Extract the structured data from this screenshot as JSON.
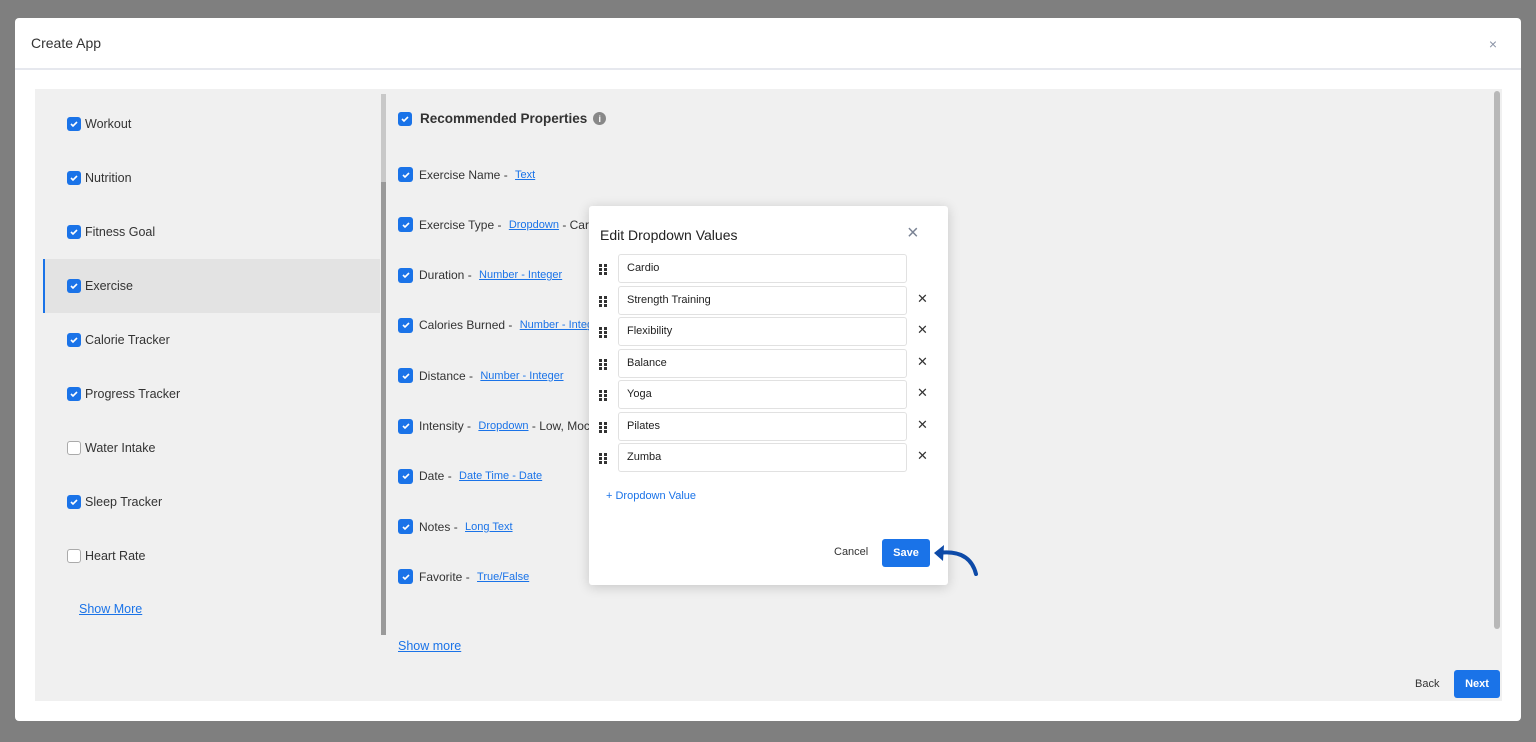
{
  "dialog": {
    "title": "Create App",
    "close": "×"
  },
  "sidebar": {
    "items": [
      {
        "label": "Workout",
        "checked": true
      },
      {
        "label": "Nutrition",
        "checked": true
      },
      {
        "label": "Fitness Goal",
        "checked": true
      },
      {
        "label": "Exercise",
        "checked": true,
        "selected": true
      },
      {
        "label": "Calorie Tracker",
        "checked": true
      },
      {
        "label": "Progress Tracker",
        "checked": true
      },
      {
        "label": "Water Intake",
        "checked": false
      },
      {
        "label": "Sleep Tracker",
        "checked": true
      },
      {
        "label": "Heart Rate",
        "checked": false
      }
    ],
    "show_more": "Show More"
  },
  "properties": {
    "heading": "Recommended Properties",
    "info_icon": "i",
    "items": [
      {
        "name": "Exercise Name",
        "type": "Text",
        "extra": ""
      },
      {
        "name": "Exercise Type",
        "type": "Dropdown",
        "extra": "- Card"
      },
      {
        "name": "Duration",
        "type": "Number - Integer",
        "extra": ""
      },
      {
        "name": "Calories Burned",
        "type": "Number - Integ",
        "extra": ""
      },
      {
        "name": "Distance",
        "type": "Number - Integer",
        "extra": ""
      },
      {
        "name": "Intensity",
        "type": "Dropdown",
        "extra": "- Low, Moc"
      },
      {
        "name": "Date",
        "type": "Date Time - Date",
        "extra": ""
      },
      {
        "name": "Notes",
        "type": "Long Text",
        "extra": ""
      },
      {
        "name": "Favorite",
        "type": "True/False",
        "extra": ""
      }
    ],
    "show_more": "Show more"
  },
  "footer": {
    "back": "Back",
    "next": "Next"
  },
  "modal": {
    "title": "Edit Dropdown Values",
    "close": "×",
    "values": [
      "Cardio",
      "Strength Training",
      "Flexibility",
      "Balance",
      "Yoga",
      "Pilates",
      "Zumba"
    ],
    "add": "+ Dropdown Value",
    "cancel": "Cancel",
    "save": "Save"
  },
  "colors": {
    "accent": "#1a73e8",
    "annotation_arrow": "#0d4aa8"
  }
}
